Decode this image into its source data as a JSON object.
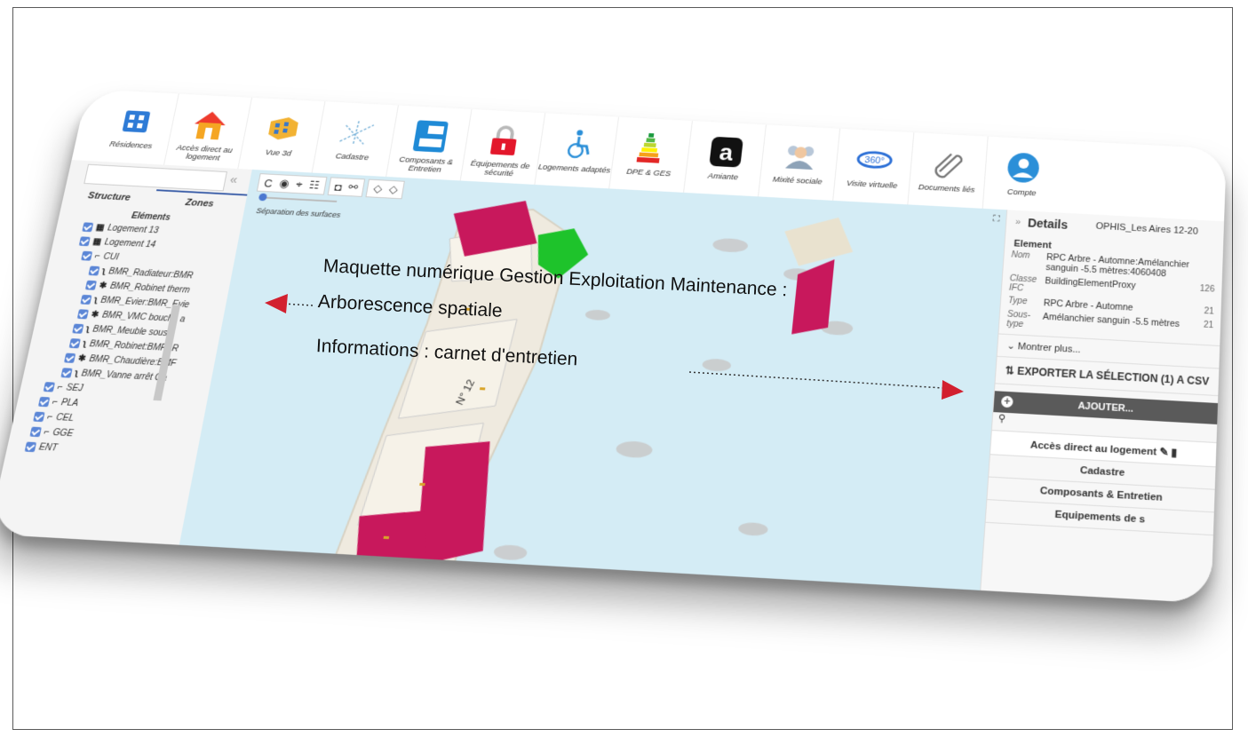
{
  "toolbar": {
    "items": [
      {
        "label": "Résidences",
        "icon": "residences-icon"
      },
      {
        "label": "Accès direct au logement",
        "icon": "home-icon"
      },
      {
        "label": "Vue 3d",
        "icon": "building-3d-icon"
      },
      {
        "label": "Cadastre",
        "icon": "cadastre-map-icon"
      },
      {
        "label": "Composants & Entretien",
        "icon": "components-icon"
      },
      {
        "label": "Équipements de sécurité",
        "icon": "lock-icon"
      },
      {
        "label": "Logements adaptés",
        "icon": "wheelchair-icon"
      },
      {
        "label": "DPE & GES",
        "icon": "energy-rating-icon"
      },
      {
        "label": "Amiante",
        "icon": "asbestos-icon"
      },
      {
        "label": "Mixité sociale",
        "icon": "people-icon"
      },
      {
        "label": "Visite virtuelle",
        "icon": "360-icon"
      },
      {
        "label": "Documents liés",
        "icon": "paperclip-icon"
      },
      {
        "label": "Compte",
        "icon": "account-icon"
      }
    ]
  },
  "left": {
    "collapse": "«",
    "tabs": [
      "Structure",
      "Zones"
    ],
    "tree_title": "Eléments",
    "tree": [
      {
        "label": "Logement 13",
        "glyph": "▦"
      },
      {
        "label": "Logement 14",
        "glyph": "▦"
      },
      {
        "label": "CUI",
        "glyph": "⌐"
      },
      {
        "label": "BMR_Radiateur:BMR",
        "glyph": "ʅ"
      },
      {
        "label": "BMR_Robinet therm",
        "glyph": "✱"
      },
      {
        "label": "BMR_Evier:BMR_Evie",
        "glyph": "ʅ"
      },
      {
        "label": "BMR_VMC bouche a",
        "glyph": "✱"
      },
      {
        "label": "BMR_Meuble sous e",
        "glyph": "ʅ"
      },
      {
        "label": "BMR_Robinet:BMR_R",
        "glyph": "ʅ"
      },
      {
        "label": "BMR_Chaudière:BMF",
        "glyph": "✱"
      },
      {
        "label": "BMR_Vanne arrêt Ga",
        "glyph": "ʅ"
      },
      {
        "label": "SEJ",
        "glyph": "⌐"
      },
      {
        "label": "PLA",
        "glyph": "⌐"
      },
      {
        "label": "CEL",
        "glyph": "⌐"
      },
      {
        "label": "GGE",
        "glyph": "⌐"
      },
      {
        "label": "ENT",
        "glyph": ""
      }
    ]
  },
  "viewer": {
    "tools": [
      "C",
      "◉",
      "⌖",
      "☷",
      "◘",
      "⚯",
      "◇",
      "◇"
    ],
    "separation_label": "Séparation des surfaces",
    "fullscreen": "⛶",
    "street_label": "N° 12"
  },
  "details": {
    "title": "Details",
    "project": "OPHIS_Les Aires 12-20",
    "section": "Element",
    "props": [
      {
        "k": "Nom",
        "v": "RPC Arbre - Automne:Amélanchier sanguin -5.5 mètres:4060408"
      },
      {
        "k": "Classe IFC",
        "v": "BuildingElementProxy",
        "n": "126"
      },
      {
        "k": "Type",
        "v": "RPC Arbre - Automne",
        "n": "21"
      },
      {
        "k": "Sous-type",
        "v": "Amélanchier sanguin -5.5 mètres",
        "n": "21"
      }
    ],
    "more": "Montrer plus...",
    "export": "EXPORTER LA SÉLECTION (1) A CSV",
    "add": "AJOUTER...",
    "list": [
      "Accès direct au logement",
      "Cadastre",
      "Composants & Entretien",
      "Equipements de s"
    ]
  },
  "annotations": {
    "line1": "Maquette numérique Gestion Exploitation Maintenance :",
    "line2": "Arborescence spatiale",
    "line3": "Informations : carnet d'entretien"
  },
  "colors": {
    "accent": "#cf2750",
    "water": "#d4ecf5",
    "arrow": "#d2202f",
    "checkbox": "#5b86d6"
  }
}
